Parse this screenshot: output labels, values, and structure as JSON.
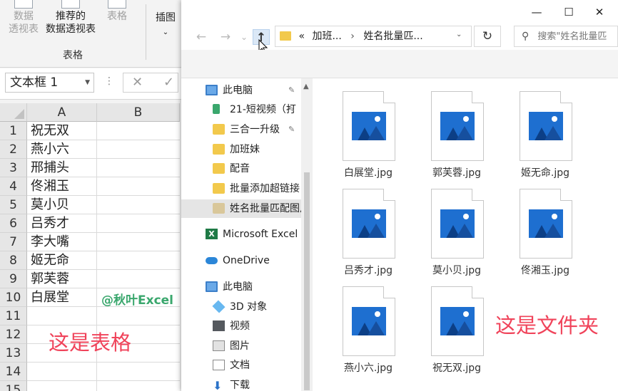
{
  "excel": {
    "ribbon": {
      "pivot_table_label_1": "数据",
      "pivot_table_label_2": "透视表",
      "recommended_pivot_label_1": "推荐的",
      "recommended_pivot_label_2": "数据透视表",
      "table_label": "表格",
      "insert_illustration_label": "插图",
      "group_label": "表格"
    },
    "formula_bar": {
      "name_box_value": "文本框 1",
      "cancel_symbol": "✕",
      "enter_symbol": "✓"
    },
    "columns": [
      "A",
      "B"
    ],
    "rows": [
      {
        "num": "1",
        "a": "祝无双"
      },
      {
        "num": "2",
        "a": "燕小六"
      },
      {
        "num": "3",
        "a": "邢捕头"
      },
      {
        "num": "4",
        "a": "佟湘玉"
      },
      {
        "num": "5",
        "a": "莫小贝"
      },
      {
        "num": "6",
        "a": "吕秀才"
      },
      {
        "num": "7",
        "a": "李大嘴"
      },
      {
        "num": "8",
        "a": "姬无命"
      },
      {
        "num": "9",
        "a": "郭芙蓉"
      },
      {
        "num": "10",
        "a": "白展堂"
      },
      {
        "num": "11",
        "a": ""
      },
      {
        "num": "12",
        "a": ""
      },
      {
        "num": "13",
        "a": ""
      },
      {
        "num": "14",
        "a": ""
      },
      {
        "num": "15",
        "a": ""
      }
    ],
    "watermark": "@秋叶Excel",
    "annotation": "这是表格"
  },
  "explorer": {
    "window_controls": {
      "minimize": "—",
      "maximize": "☐",
      "close": "✕"
    },
    "nav_buttons": {
      "back": "←",
      "forward": "→",
      "recent": "⌄",
      "up": "↑"
    },
    "address": {
      "prefix": "«",
      "crumb_1": "加班...",
      "separator": "›",
      "crumb_2": "姓名批量匹...",
      "dropdown": "⌄"
    },
    "refresh": "↻",
    "search_placeholder": "搜索\"姓名批量匹",
    "nav_pane": [
      {
        "label": "此电脑",
        "icon": "pc-icon",
        "pinned": true
      },
      {
        "label": "21-短视频（打",
        "icon": "pin-folder-icon",
        "pinned": true
      },
      {
        "label": "三合一升级",
        "icon": "folder-icon",
        "pinned": true
      },
      {
        "label": "加班妹",
        "icon": "folder-icon",
        "pinned": false
      },
      {
        "label": "配音",
        "icon": "folder-icon",
        "pinned": false
      },
      {
        "label": "批量添加超链接",
        "icon": "folder-icon",
        "pinned": false
      },
      {
        "label": "姓名批量匹配图片",
        "icon": "folder-icon",
        "pinned": false
      },
      {
        "label": "Microsoft Excel",
        "icon": "excel-icon",
        "pinned": false
      },
      {
        "label": "OneDrive",
        "icon": "onedrive-icon",
        "pinned": false
      },
      {
        "label": "此电脑",
        "icon": "pc-icon",
        "pinned": false
      },
      {
        "label": "3D 对象",
        "icon": "3d-objects-icon",
        "pinned": false
      },
      {
        "label": "视频",
        "icon": "video-icon",
        "pinned": false
      },
      {
        "label": "图片",
        "icon": "pictures-icon",
        "pinned": false
      },
      {
        "label": "文档",
        "icon": "documents-icon",
        "pinned": false
      },
      {
        "label": "下载",
        "icon": "download-icon",
        "pinned": false
      }
    ],
    "pin_glyph": "📌",
    "files": [
      {
        "name": "白展堂.jpg"
      },
      {
        "name": "郭芙蓉.jpg"
      },
      {
        "name": "姬无命.jpg"
      },
      {
        "name": "吕秀才.jpg"
      },
      {
        "name": "莫小贝.jpg"
      },
      {
        "name": "佟湘玉.jpg"
      },
      {
        "name": "燕小六.jpg"
      },
      {
        "name": "祝无双.jpg"
      }
    ],
    "annotation": "这是文件夹"
  }
}
